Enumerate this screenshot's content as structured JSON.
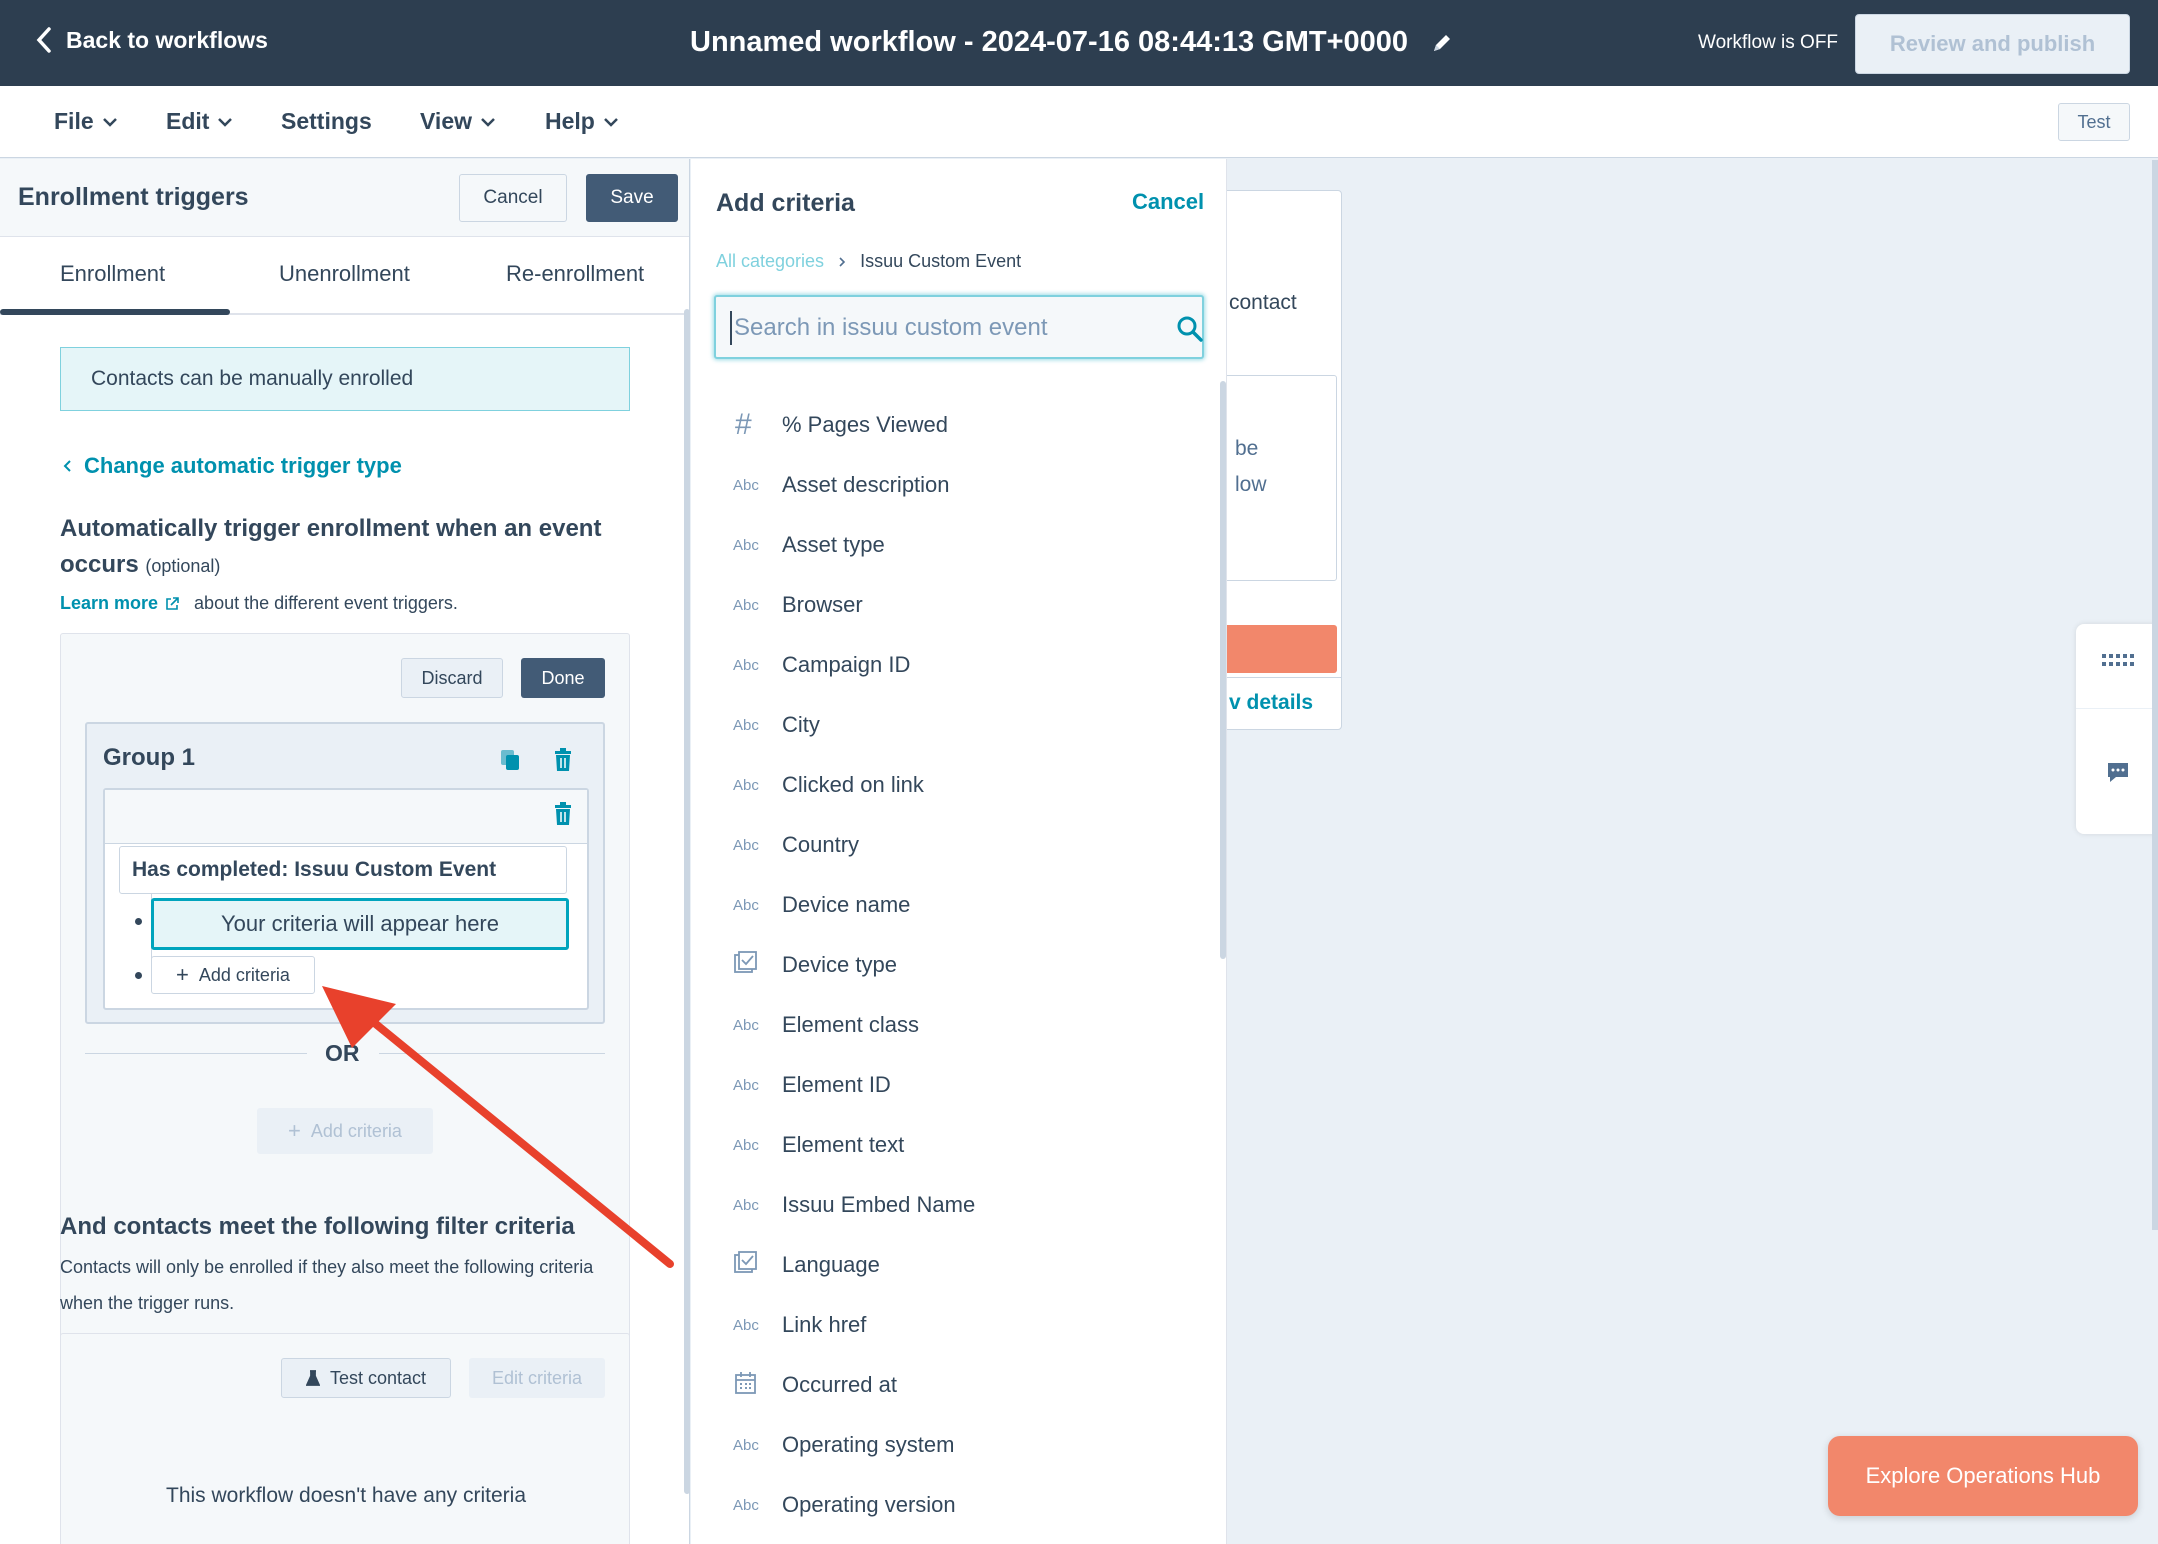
{
  "topbar": {
    "back_label": "Back to workflows",
    "title": "Unnamed workflow - 2024-07-16 08:44:13 GMT+0000",
    "status": "Workflow is OFF",
    "publish_label": "Review and publish"
  },
  "menubar": {
    "file": "File",
    "edit": "Edit",
    "settings": "Settings",
    "view": "View",
    "help": "Help",
    "test": "Test"
  },
  "left_panel": {
    "title": "Enrollment triggers",
    "cancel": "Cancel",
    "save": "Save",
    "tabs": [
      "Enrollment",
      "Unenrollment",
      "Re-enrollment"
    ],
    "manual_info": "Contacts can be manually enrolled",
    "change_trigger": "Change automatic trigger type",
    "auto_heading": "Automatically trigger enrollment when an event occurs",
    "auto_optional": "(optional)",
    "learn_more": "Learn more",
    "learn_more_suffix": "about the different event triggers.",
    "discard": "Discard",
    "done": "Done",
    "group_label": "Group 1",
    "completed": "Has completed: Issuu Custom Event",
    "criteria_placeholder": "Your criteria will appear here",
    "add_criteria": "Add criteria",
    "or": "OR",
    "add_criteria_disabled": "Add criteria",
    "filter_heading": "And contacts meet the following filter criteria",
    "filter_desc": "Contacts will only be enrolled if they also meet the following criteria when the trigger runs.",
    "test_contact": "Test contact",
    "edit_criteria": "Edit criteria",
    "no_criteria": "This workflow doesn't have any criteria"
  },
  "canvas_card": {
    "text1": "contact",
    "text2a": "be",
    "text2b": "low",
    "details": "v details"
  },
  "mid_panel": {
    "title": "Add criteria",
    "cancel": "Cancel",
    "breadcrumb_all": "All categories",
    "breadcrumb_current": "Issuu Custom Event",
    "search_placeholder": "Search in issuu custom event",
    "properties": [
      {
        "type": "number",
        "type_label": "#",
        "label": "% Pages Viewed"
      },
      {
        "type": "text",
        "type_label": "Abc",
        "label": "Asset description"
      },
      {
        "type": "text",
        "type_label": "Abc",
        "label": "Asset type"
      },
      {
        "type": "text",
        "type_label": "Abc",
        "label": "Browser"
      },
      {
        "type": "text",
        "type_label": "Abc",
        "label": "Campaign ID"
      },
      {
        "type": "text",
        "type_label": "Abc",
        "label": "City"
      },
      {
        "type": "text",
        "type_label": "Abc",
        "label": "Clicked on link"
      },
      {
        "type": "text",
        "type_label": "Abc",
        "label": "Country"
      },
      {
        "type": "text",
        "type_label": "Abc",
        "label": "Device name"
      },
      {
        "type": "enum",
        "type_label": "",
        "label": "Device type"
      },
      {
        "type": "text",
        "type_label": "Abc",
        "label": "Element class"
      },
      {
        "type": "text",
        "type_label": "Abc",
        "label": "Element ID"
      },
      {
        "type": "text",
        "type_label": "Abc",
        "label": "Element text"
      },
      {
        "type": "text",
        "type_label": "Abc",
        "label": "Issuu Embed Name"
      },
      {
        "type": "enum",
        "type_label": "",
        "label": "Language"
      },
      {
        "type": "text",
        "type_label": "Abc",
        "label": "Link href"
      },
      {
        "type": "date",
        "type_label": "",
        "label": "Occurred at"
      },
      {
        "type": "text",
        "type_label": "Abc",
        "label": "Operating system"
      },
      {
        "type": "text",
        "type_label": "Abc",
        "label": "Operating version"
      }
    ]
  },
  "explore": "Explore Operations Hub",
  "colors": {
    "header_bg": "#2d3e50",
    "accent_teal": "#0091ae",
    "primary_button": "#425b76",
    "orange": "#f2876b",
    "annotation_arrow": "#e8412c"
  }
}
